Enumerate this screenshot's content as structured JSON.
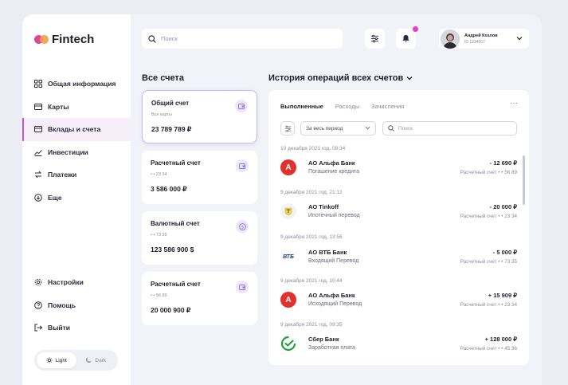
{
  "app": {
    "name": "Fintech"
  },
  "sidebar": {
    "items": [
      {
        "label": "Общая информация",
        "icon": "grid-icon"
      },
      {
        "label": "Карты",
        "icon": "card-icon"
      },
      {
        "label": "Вклады и счета",
        "icon": "wallet-icon",
        "active": true
      },
      {
        "label": "Инвестиции",
        "icon": "chart-icon"
      },
      {
        "label": "Платежи",
        "icon": "transfer-icon"
      },
      {
        "label": "Еще",
        "icon": "arrow-down-circle-icon"
      }
    ],
    "bottom_items": [
      {
        "label": "Настройки",
        "icon": "gear-icon"
      },
      {
        "label": "Помощь",
        "icon": "help-icon"
      },
      {
        "label": "Выйти",
        "icon": "logout-icon"
      }
    ],
    "theme": {
      "light": "Light",
      "dark": "Dark",
      "selected": "Light"
    }
  },
  "header": {
    "search_placeholder": "Поиск",
    "user": {
      "name": "Андрей Козлов",
      "id": "ID 1234567"
    }
  },
  "accounts": {
    "title": "Все счета",
    "cards": [
      {
        "name": "Общий счет",
        "sub": "Все карты",
        "amount": "23 789 789 ₽",
        "icon": "wallet-icon",
        "selected": true
      },
      {
        "name": "Расчетный счет",
        "sub": "• • 23 34",
        "amount": "3 586 000 ₽",
        "icon": "wallet-icon"
      },
      {
        "name": "Валютный счет",
        "sub": "• • 73 35",
        "amount": "123 586 900 $",
        "icon": "dollar-icon"
      },
      {
        "name": "Расчетный счет",
        "sub": "• • 56 89",
        "amount": "20 000 900 ₽",
        "icon": "wallet-icon"
      }
    ]
  },
  "history": {
    "title": "История операций всех счетов",
    "tabs": [
      "Выполненные",
      "Расходы",
      "Зачисления"
    ],
    "active_tab": "Выполненные",
    "more": "···",
    "period": "За весь период",
    "search_placeholder": "Поиск",
    "operations": [
      {
        "date": "10 декабря 2021 год, 08:34",
        "bank": "АО Альфа Банк",
        "desc": "Погашение кредита",
        "amount": "- 12 690 ₽",
        "account": "Расчетный счет  • • 56 89",
        "logo": "alfa-logo",
        "logo_text": "A",
        "logo_color": "#e0312f"
      },
      {
        "date": "9 декабря 2021 год, 21:12",
        "bank": "АО  Tinkoff",
        "desc": "Ипотечный перевод",
        "amount": "- 20 000 ₽",
        "account": "Расчетный счет  • • 23 34",
        "logo": "tinkoff-logo",
        "logo_text": "",
        "logo_color": "#f2f2f2"
      },
      {
        "date": "9 декабря 2021 год, 13:56",
        "bank": "АО ВТБ Банк",
        "desc": "Входящий Перевод",
        "amount": "- 5 000 ₽",
        "account": "Расчетный счет  • • 73 35",
        "logo": "vtb-logo",
        "logo_text": "ВТБ",
        "logo_color": "#ffffff"
      },
      {
        "date": "9 декабря 2021 год, 10:44",
        "bank": "АО Альфа Банк",
        "desc": "Исходящий Перевод",
        "amount": "+ 15 909 ₽",
        "account": "Расчетный счет  • • 23 34",
        "logo": "alfa-logo",
        "logo_text": "A",
        "logo_color": "#e0312f"
      },
      {
        "date": "9 декабря 2021 год, 09:35",
        "bank": "Сбер Банк",
        "desc": "Заработная плата",
        "amount": "+ 128 000 ₽",
        "account": "Расчетный счет  • • 45 36",
        "logo": "sber-logo",
        "logo_text": "",
        "logo_color": "#ffffff"
      }
    ]
  },
  "colors": {
    "accent": "#c455c8",
    "active_bg": "#f6eff9",
    "card_selected_border": "#c6b7ec",
    "notification": "#e040c8"
  }
}
